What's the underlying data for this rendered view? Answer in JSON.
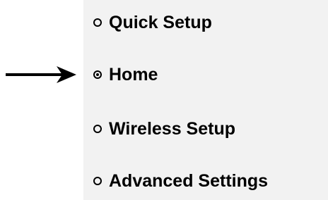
{
  "menu": {
    "items": [
      {
        "label": "Quick Setup",
        "selected": false,
        "icon": "radio-empty-icon"
      },
      {
        "label": "Home",
        "selected": true,
        "icon": "radio-selected-icon"
      },
      {
        "label": "Wireless Setup",
        "selected": false,
        "icon": "radio-empty-icon"
      },
      {
        "label": "Advanced Settings",
        "selected": false,
        "icon": "radio-empty-icon"
      }
    ]
  },
  "pointer": {
    "icon": "arrow-right-icon",
    "points_to": "Home"
  },
  "colors": {
    "panel_background": "#f2f2f2",
    "text": "#000000",
    "page_background": "#ffffff"
  }
}
